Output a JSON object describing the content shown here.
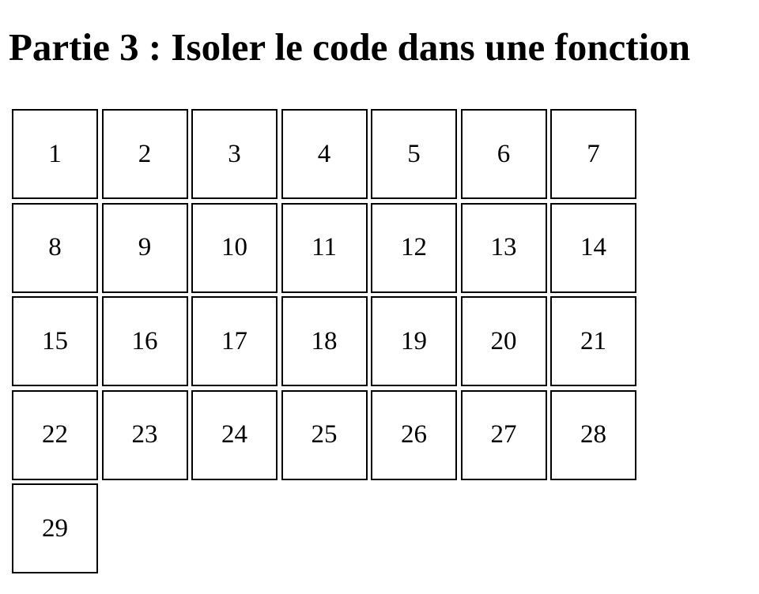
{
  "heading": "Partie 3 : Isoler le code dans une fonction",
  "days": [
    "1",
    "2",
    "3",
    "4",
    "5",
    "6",
    "7",
    "8",
    "9",
    "10",
    "11",
    "12",
    "13",
    "14",
    "15",
    "16",
    "17",
    "18",
    "19",
    "20",
    "21",
    "22",
    "23",
    "24",
    "25",
    "26",
    "27",
    "28",
    "29"
  ]
}
